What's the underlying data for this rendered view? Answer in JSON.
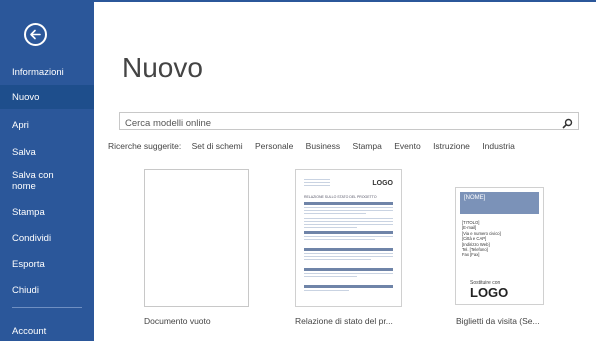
{
  "sidebar": {
    "items": [
      {
        "label": "Informazioni"
      },
      {
        "label": "Nuovo"
      },
      {
        "label": "Apri"
      },
      {
        "label": "Salva"
      },
      {
        "label": "Salva con nome"
      },
      {
        "label": "Stampa"
      },
      {
        "label": "Condividi"
      },
      {
        "label": "Esporta"
      },
      {
        "label": "Chiudi"
      },
      {
        "label": "Account"
      }
    ]
  },
  "main": {
    "title": "Nuovo",
    "search_placeholder": "Cerca modelli online",
    "suggest_label": "Ricerche suggerite:",
    "suggestions": [
      "Set di schemi",
      "Personale",
      "Business",
      "Stampa",
      "Evento",
      "Istruzione",
      "Industria"
    ],
    "templates": [
      {
        "label": "Documento vuoto"
      },
      {
        "label": "Relazione di stato del pr...",
        "logo": "LOGO",
        "heading": "RELAZIONE SULLO STATO DEL PROGETTO"
      },
      {
        "label": "Biglietti da visita (Se...",
        "name_field": "[NOME]",
        "fields": [
          "[TITOLO]",
          "[E-mail]",
          "[Via e numero civico]",
          "[Città e CAP]",
          "[Indirizzo Web]",
          "Tel. [Telefono]",
          "Fax [Fax]"
        ],
        "logo_caption": "Sostituire con",
        "logo": "LOGO"
      }
    ]
  },
  "colors": {
    "accent": "#2b579a",
    "accent_active": "#1e4e8c"
  }
}
